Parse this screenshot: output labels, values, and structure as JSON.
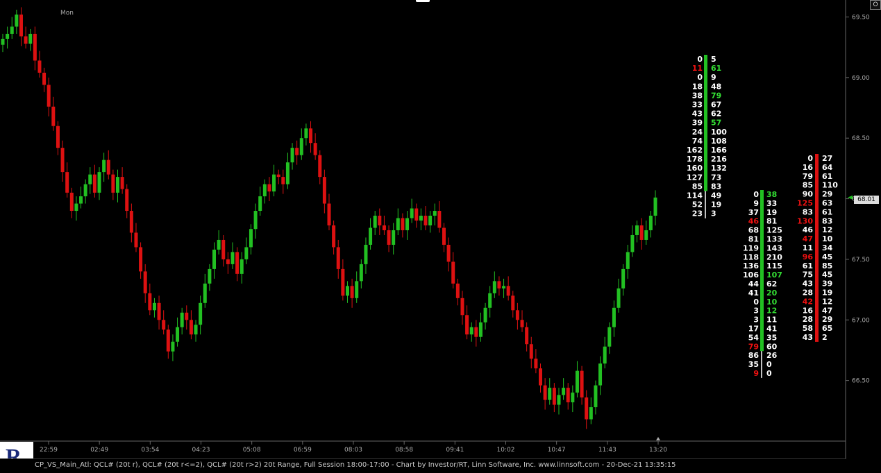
{
  "session_label": "Mon",
  "corner_button": "O",
  "last_price_label": "68.01",
  "status_bar": "CP_VS_Main_Atl: QCL# (20t r), QCL# (20t r<=2), QCL# (20t r>2) 20t Range, Full Session 18:00-17:00 - Chart by Investor/RT, Linn Software, Inc. www.linnsoft.com - 20-Dec-21 13:35:15",
  "colors": {
    "up": "#22c022",
    "down": "#dd1111",
    "axis": "#666666",
    "text": "#ffffff"
  },
  "chart_data": {
    "type": "candlestick",
    "y_ticks": [
      "69.50",
      "69.00",
      "68.50",
      "68.00",
      "67.50",
      "67.00",
      "66.50"
    ],
    "ylim": [
      66.0,
      69.64
    ],
    "x_ticks": [
      "22:59",
      "02:49",
      "03:54",
      "04:23",
      "05:08",
      "06:59",
      "08:03",
      "08:58",
      "09:41",
      "10:02",
      "10:47",
      "11:43",
      "13:20"
    ],
    "closes": [
      69.32,
      69.36,
      69.42,
      69.52,
      69.34,
      69.28,
      69.36,
      69.14,
      69.04,
      68.94,
      68.76,
      68.6,
      68.42,
      68.22,
      68.05,
      67.9,
      67.96,
      68.02,
      68.12,
      68.2,
      68.05,
      68.22,
      68.32,
      68.2,
      68.05,
      68.18,
      68.08,
      67.9,
      67.72,
      67.6,
      67.4,
      67.22,
      67.08,
      67.14,
      67.0,
      66.92,
      66.74,
      66.82,
      66.94,
      67.06,
      67.0,
      66.88,
      66.96,
      67.14,
      67.3,
      67.42,
      67.58,
      67.66,
      67.5,
      67.46,
      67.56,
      67.38,
      67.5,
      67.6,
      67.75,
      67.9,
      68.02,
      68.12,
      68.06,
      68.2,
      68.18,
      68.12,
      68.3,
      68.42,
      68.36,
      68.5,
      68.58,
      68.46,
      68.36,
      68.18,
      67.96,
      67.78,
      67.6,
      67.42,
      67.2,
      67.28,
      67.18,
      67.32,
      67.46,
      67.62,
      67.76,
      67.86,
      67.78,
      67.74,
      67.62,
      67.74,
      67.84,
      67.74,
      67.84,
      67.92,
      67.82,
      67.86,
      67.78,
      67.86,
      67.9,
      67.76,
      67.62,
      67.48,
      67.3,
      67.18,
      67.04,
      66.88,
      66.94,
      66.86,
      66.98,
      67.1,
      67.22,
      67.32,
      67.26,
      67.28,
      67.2,
      67.08,
      67.0,
      66.94,
      66.8,
      66.68,
      66.6,
      66.46,
      66.34,
      66.44,
      66.3,
      66.38,
      66.44,
      66.32,
      66.4,
      66.58,
      66.36,
      66.18,
      66.28,
      66.46,
      66.64,
      66.78,
      66.94,
      67.1,
      67.26,
      67.42,
      67.56,
      67.7,
      67.78,
      67.66,
      67.74,
      67.86,
      68.01
    ],
    "ladders": [
      {
        "rows": [
          {
            "bid": "0",
            "ask": "5",
            "bc": "w",
            "ac": "w"
          },
          {
            "bid": "11",
            "ask": "61",
            "bc": "r",
            "ac": "g"
          },
          {
            "bid": "0",
            "ask": "9",
            "bc": "w",
            "ac": "w"
          },
          {
            "bid": "18",
            "ask": "48",
            "bc": "w",
            "ac": "w"
          },
          {
            "bid": "38",
            "ask": "79",
            "bc": "w",
            "ac": "g"
          },
          {
            "bid": "33",
            "ask": "67",
            "bc": "w",
            "ac": "w"
          },
          {
            "bid": "43",
            "ask": "62",
            "bc": "w",
            "ac": "w"
          },
          {
            "bid": "39",
            "ask": "57",
            "bc": "w",
            "ac": "g"
          },
          {
            "bid": "24",
            "ask": "100",
            "bc": "w",
            "ac": "w"
          },
          {
            "bid": "74",
            "ask": "108",
            "bc": "w",
            "ac": "w"
          },
          {
            "bid": "162",
            "ask": "166",
            "bc": "w",
            "ac": "w"
          },
          {
            "bid": "178",
            "ask": "216",
            "bc": "w",
            "ac": "w"
          },
          {
            "bid": "160",
            "ask": "132",
            "bc": "w",
            "ac": "w"
          },
          {
            "bid": "127",
            "ask": "73",
            "bc": "w",
            "ac": "w"
          },
          {
            "bid": "85",
            "ask": "83",
            "bc": "w",
            "ac": "w"
          },
          {
            "bid": "114",
            "ask": "49",
            "bc": "w",
            "ac": "w"
          },
          {
            "bid": "52",
            "ask": "19",
            "bc": "w",
            "ac": "w"
          },
          {
            "bid": "23",
            "ask": "3",
            "bc": "w",
            "ac": "w"
          }
        ]
      },
      {
        "rows": [
          {
            "bid": "0",
            "ask": "38",
            "bc": "w",
            "ac": "g"
          },
          {
            "bid": "9",
            "ask": "33",
            "bc": "w",
            "ac": "w"
          },
          {
            "bid": "37",
            "ask": "19",
            "bc": "w",
            "ac": "w"
          },
          {
            "bid": "46",
            "ask": "81",
            "bc": "r",
            "ac": "w"
          },
          {
            "bid": "68",
            "ask": "125",
            "bc": "w",
            "ac": "w"
          },
          {
            "bid": "81",
            "ask": "133",
            "bc": "w",
            "ac": "w"
          },
          {
            "bid": "119",
            "ask": "143",
            "bc": "w",
            "ac": "w"
          },
          {
            "bid": "118",
            "ask": "210",
            "bc": "w",
            "ac": "w"
          },
          {
            "bid": "136",
            "ask": "115",
            "bc": "w",
            "ac": "w"
          },
          {
            "bid": "106",
            "ask": "107",
            "bc": "w",
            "ac": "g"
          },
          {
            "bid": "44",
            "ask": "62",
            "bc": "w",
            "ac": "w"
          },
          {
            "bid": "41",
            "ask": "20",
            "bc": "w",
            "ac": "g"
          },
          {
            "bid": "0",
            "ask": "10",
            "bc": "w",
            "ac": "g"
          },
          {
            "bid": "3",
            "ask": "12",
            "bc": "w",
            "ac": "g"
          },
          {
            "bid": "3",
            "ask": "11",
            "bc": "w",
            "ac": "w"
          },
          {
            "bid": "17",
            "ask": "41",
            "bc": "w",
            "ac": "w"
          },
          {
            "bid": "54",
            "ask": "35",
            "bc": "w",
            "ac": "w"
          },
          {
            "bid": "79",
            "ask": "60",
            "bc": "r",
            "ac": "w"
          },
          {
            "bid": "86",
            "ask": "26",
            "bc": "w",
            "ac": "w"
          },
          {
            "bid": "35",
            "ask": "0",
            "bc": "w",
            "ac": "w"
          },
          {
            "bid": "9",
            "ask": "0",
            "bc": "r",
            "ac": "w"
          }
        ]
      },
      {
        "rows": [
          {
            "bid": "0",
            "ask": "27",
            "bc": "w",
            "ac": "w"
          },
          {
            "bid": "16",
            "ask": "64",
            "bc": "w",
            "ac": "w"
          },
          {
            "bid": "79",
            "ask": "61",
            "bc": "w",
            "ac": "w"
          },
          {
            "bid": "85",
            "ask": "110",
            "bc": "w",
            "ac": "w"
          },
          {
            "bid": "90",
            "ask": "29",
            "bc": "w",
            "ac": "w"
          },
          {
            "bid": "125",
            "ask": "63",
            "bc": "r",
            "ac": "w"
          },
          {
            "bid": "83",
            "ask": "61",
            "bc": "w",
            "ac": "w"
          },
          {
            "bid": "130",
            "ask": "83",
            "bc": "r",
            "ac": "w"
          },
          {
            "bid": "46",
            "ask": "12",
            "bc": "w",
            "ac": "w"
          },
          {
            "bid": "47",
            "ask": "10",
            "bc": "r",
            "ac": "w"
          },
          {
            "bid": "11",
            "ask": "34",
            "bc": "w",
            "ac": "w"
          },
          {
            "bid": "96",
            "ask": "45",
            "bc": "r",
            "ac": "w"
          },
          {
            "bid": "61",
            "ask": "85",
            "bc": "w",
            "ac": "w"
          },
          {
            "bid": "75",
            "ask": "45",
            "bc": "w",
            "ac": "w"
          },
          {
            "bid": "43",
            "ask": "39",
            "bc": "w",
            "ac": "w"
          },
          {
            "bid": "28",
            "ask": "19",
            "bc": "w",
            "ac": "w"
          },
          {
            "bid": "42",
            "ask": "12",
            "bc": "r",
            "ac": "w"
          },
          {
            "bid": "16",
            "ask": "47",
            "bc": "w",
            "ac": "w"
          },
          {
            "bid": "28",
            "ask": "29",
            "bc": "w",
            "ac": "w"
          },
          {
            "bid": "58",
            "ask": "65",
            "bc": "w",
            "ac": "w"
          },
          {
            "bid": "43",
            "ask": "2",
            "bc": "w",
            "ac": "w"
          }
        ]
      }
    ]
  }
}
